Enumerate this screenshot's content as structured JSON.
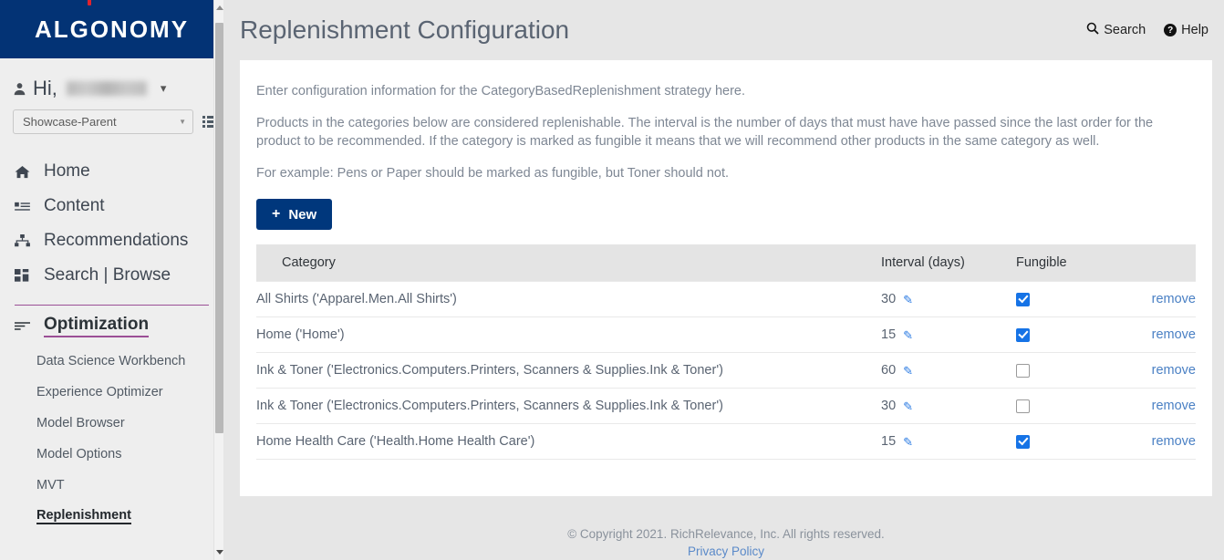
{
  "sidebar": {
    "logo": "ALGONOMY",
    "greeting_prefix": "Hi,",
    "user_name_redacted": "",
    "account_select": {
      "value": "Showcase-Parent",
      "caret": "▾"
    },
    "nav": [
      {
        "label": "Home",
        "icon": "home-icon"
      },
      {
        "label": "Content",
        "icon": "content-list-icon"
      },
      {
        "label": "Recommendations",
        "icon": "sitemap-icon"
      },
      {
        "label": "Search | Browse",
        "icon": "grid-icon"
      }
    ],
    "section": {
      "label": "Optimization",
      "icon": "sliders-icon"
    },
    "sub_items": [
      {
        "label": "Data Science Workbench",
        "active": false
      },
      {
        "label": "Experience Optimizer",
        "active": false
      },
      {
        "label": "Model Browser",
        "active": false
      },
      {
        "label": "Model Options",
        "active": false
      },
      {
        "label": "MVT",
        "active": false
      },
      {
        "label": "Replenishment",
        "active": true
      }
    ],
    "accent_color": "#9b4f96",
    "logo_band_color": "#033375"
  },
  "header": {
    "title": "Replenishment Configuration",
    "search_label": "Search",
    "help_label": "Help",
    "help_glyph": "?"
  },
  "content": {
    "paragraphs": [
      "Enter configuration information for the CategoryBasedReplenishment strategy here.",
      "Products in the categories below are considered replenishable. The interval is the number of days that must have have passed since the last order for the product to be recommended. If the category is marked as fungible it means that we will recommend other products in the same category as well.",
      "For example: Pens or Paper should be marked as fungible, but Toner should not."
    ],
    "new_button": {
      "label": "New",
      "plus": "+",
      "color": "#00377c"
    },
    "table": {
      "columns": [
        "Category",
        "Interval (days)",
        "Fungible",
        ""
      ],
      "remove_label": "remove",
      "rows": [
        {
          "category": "All Shirts ('Apparel.Men.All Shirts')",
          "interval": "30",
          "fungible": true,
          "remove": "remove"
        },
        {
          "category": "Home ('Home')",
          "interval": "15",
          "fungible": true,
          "remove": "remove"
        },
        {
          "category": "Ink & Toner ('Electronics.Computers.Printers, Scanners & Supplies.Ink & Toner')",
          "interval": "60",
          "fungible": false,
          "remove": "remove"
        },
        {
          "category": "Ink & Toner ('Electronics.Computers.Printers, Scanners & Supplies.Ink & Toner')",
          "interval": "30",
          "fungible": false,
          "remove": "remove"
        },
        {
          "category": "Home Health Care ('Health.Home Health Care')",
          "interval": "15",
          "fungible": true,
          "remove": "remove"
        }
      ]
    }
  },
  "footer": {
    "copyright": "© Copyright 2021. RichRelevance, Inc. All rights reserved.",
    "privacy_label": "Privacy Policy"
  }
}
